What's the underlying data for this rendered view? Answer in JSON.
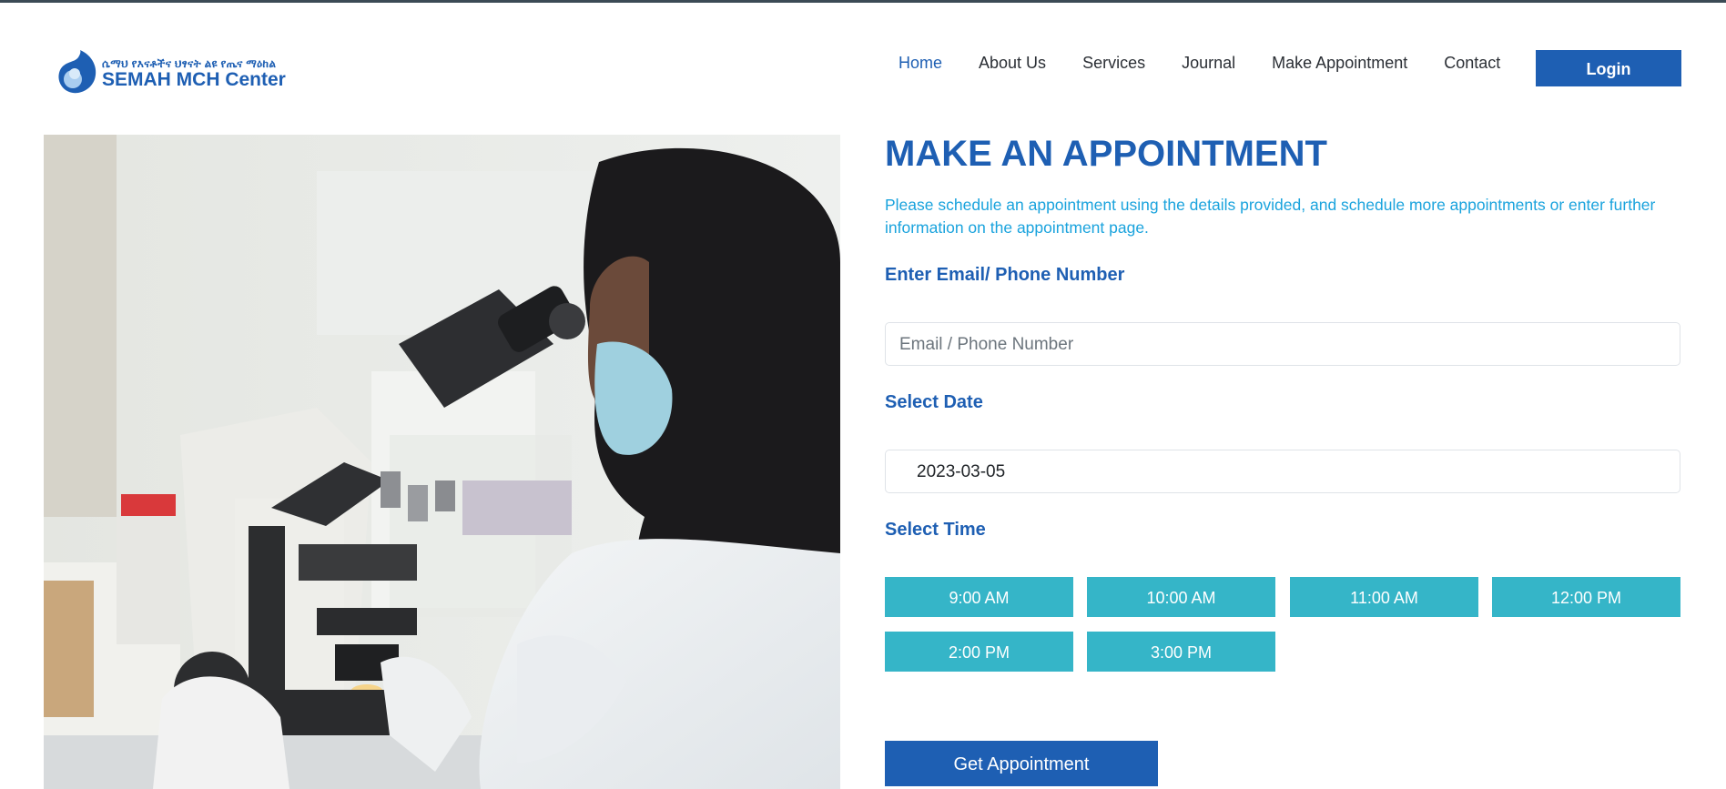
{
  "header": {
    "logo": {
      "amharic_name": "ሴማህ የእናቶችና ህፃናት ልዩ የጤና ማዕከል",
      "name": "SEMAH MCH Center"
    },
    "nav": [
      {
        "label": "Home",
        "active": true
      },
      {
        "label": "About Us"
      },
      {
        "label": "Services"
      },
      {
        "label": "Journal"
      },
      {
        "label": "Make Appointment"
      },
      {
        "label": "Contact"
      }
    ],
    "login_label": "Login"
  },
  "appointment": {
    "title": "MAKE AN APPOINTMENT",
    "description": "Please schedule an appointment using the details provided, and schedule more appointments or enter further information on the appointment page.",
    "email_label": "Enter Email/ Phone Number",
    "email_placeholder": "Email / Phone Number",
    "date_label": "Select Date",
    "date_value": "2023-03-05",
    "time_label": "Select Time",
    "time_slots": [
      "9:00 AM",
      "10:00 AM",
      "11:00 AM",
      "12:00 PM",
      "2:00 PM",
      "3:00 PM"
    ],
    "submit_label": "Get Appointment"
  },
  "colors": {
    "primary": "#1e5fb3",
    "accent_text": "#1aa3dd",
    "slot": "#35b5c8"
  }
}
